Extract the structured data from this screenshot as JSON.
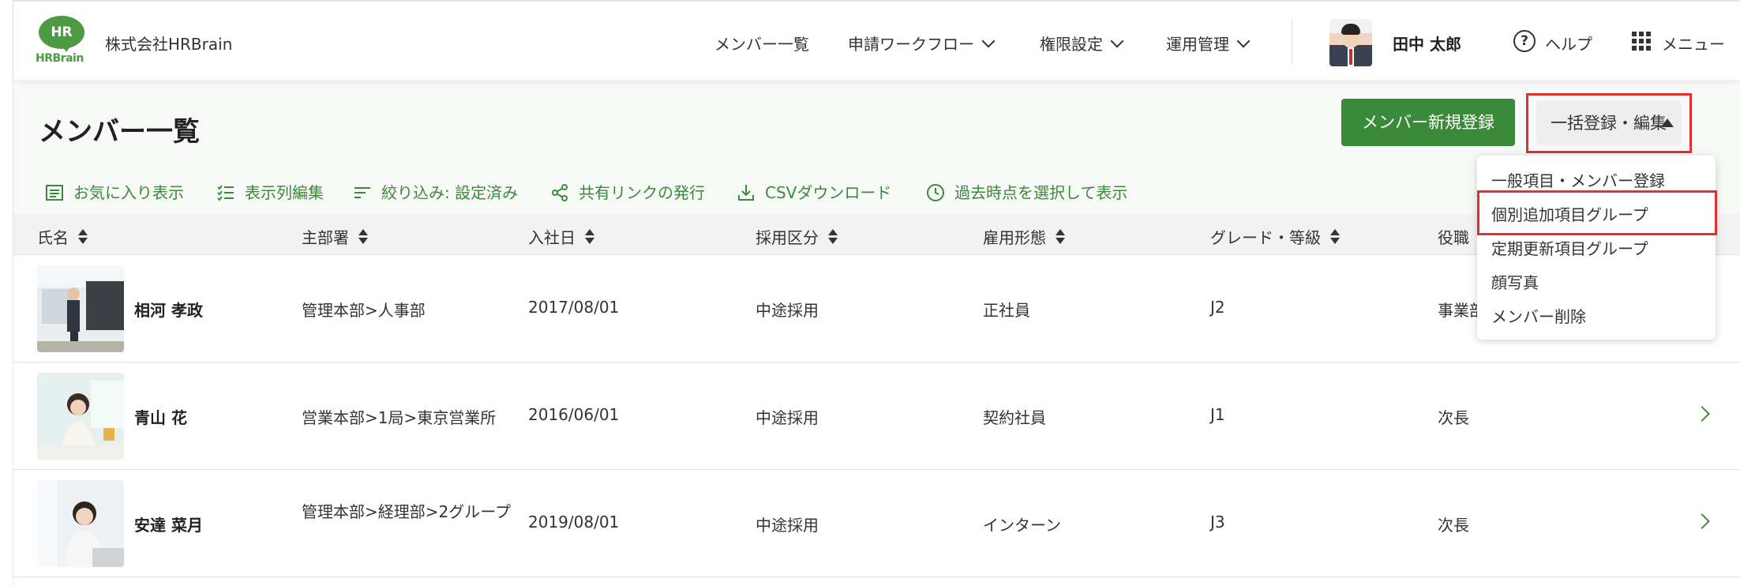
{
  "header": {
    "logo_mark": "HR",
    "logo_text": "HRBrain",
    "company": "株式会社HRBrain",
    "nav": [
      {
        "label": "メンバー一覧"
      },
      {
        "label": "申請ワークフロー"
      },
      {
        "label": "権限設定"
      },
      {
        "label": "運用管理"
      }
    ],
    "user_name": "田中 太郎",
    "help_label": "ヘルプ",
    "menu_label": "メニュー"
  },
  "page": {
    "title": "メンバー一覧",
    "register_button": "メンバー新規登録",
    "bulk_button": "一括登録・編集"
  },
  "toolbar": {
    "favorites": "お気に入り表示",
    "columns": "表示列編集",
    "filter": "絞り込み: 設定済み",
    "share": "共有リンクの発行",
    "csv": "CSVダウンロード",
    "history": "過去時点を選択して表示"
  },
  "table": {
    "columns": [
      "氏名",
      "主部署",
      "入社日",
      "採用区分",
      "雇用形態",
      "グレード・等級",
      "役職"
    ],
    "rows": [
      {
        "name": "相河 孝政",
        "department": "管理本部>人事部",
        "join_date": "2017/08/01",
        "hire_type": "中途採用",
        "employment": "正社員",
        "grade": "J2",
        "position": "事業部"
      },
      {
        "name": "青山 花",
        "department": "営業本部>1局>東京営業所",
        "join_date": "2016/06/01",
        "hire_type": "中途採用",
        "employment": "契約社員",
        "grade": "J1",
        "position": "次長"
      },
      {
        "name": "安達 菜月",
        "department": "管理本部>経理部>2グループ",
        "join_date": "2019/08/01",
        "hire_type": "中途採用",
        "employment": "インターン",
        "grade": "J3",
        "position": "次長"
      }
    ]
  },
  "dropdown": {
    "items": [
      "一般項目・メンバー登録",
      "個別追加項目グループ",
      "定期更新項目グループ",
      "顔写真",
      "メンバー削除"
    ]
  },
  "colors": {
    "accent": "#3b8a3a",
    "highlight": "#e03030"
  }
}
